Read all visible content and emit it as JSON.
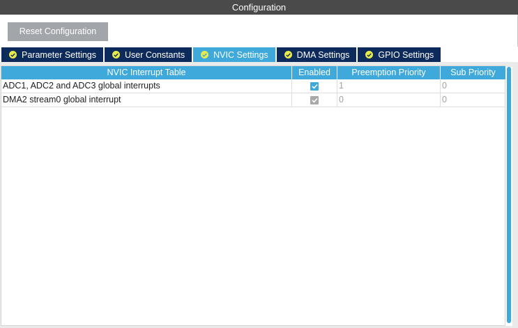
{
  "window": {
    "title": "Configuration"
  },
  "toolbar": {
    "reset_label": "Reset Configuration"
  },
  "tabs": [
    {
      "label": "Parameter Settings",
      "active": false,
      "icon": "check-circle-icon"
    },
    {
      "label": "User Constants",
      "active": false,
      "icon": "check-circle-icon"
    },
    {
      "label": "NVIC Settings",
      "active": true,
      "icon": "check-circle-icon"
    },
    {
      "label": "DMA Settings",
      "active": false,
      "icon": "check-circle-icon"
    },
    {
      "label": "GPIO Settings",
      "active": false,
      "icon": "check-circle-icon"
    }
  ],
  "table": {
    "columns": [
      "NVIC Interrupt Table",
      "Enabled",
      "Preemption Priority",
      "Sub Priority"
    ],
    "rows": [
      {
        "name": "ADC1, ADC2 and ADC3 global interrupts",
        "enabled": true,
        "editable": true,
        "preemption": "1",
        "sub": "0"
      },
      {
        "name": "DMA2 stream0 global interrupt",
        "enabled": true,
        "editable": false,
        "preemption": "0",
        "sub": "0"
      }
    ]
  },
  "colors": {
    "title_bar": "#4a4a4a",
    "tab_inactive": "#0d2a5c",
    "tab_active": "#3ea9da",
    "tab_check": "#e6ea4a",
    "header": "#3ea9da",
    "button": "#a2a5a9"
  }
}
